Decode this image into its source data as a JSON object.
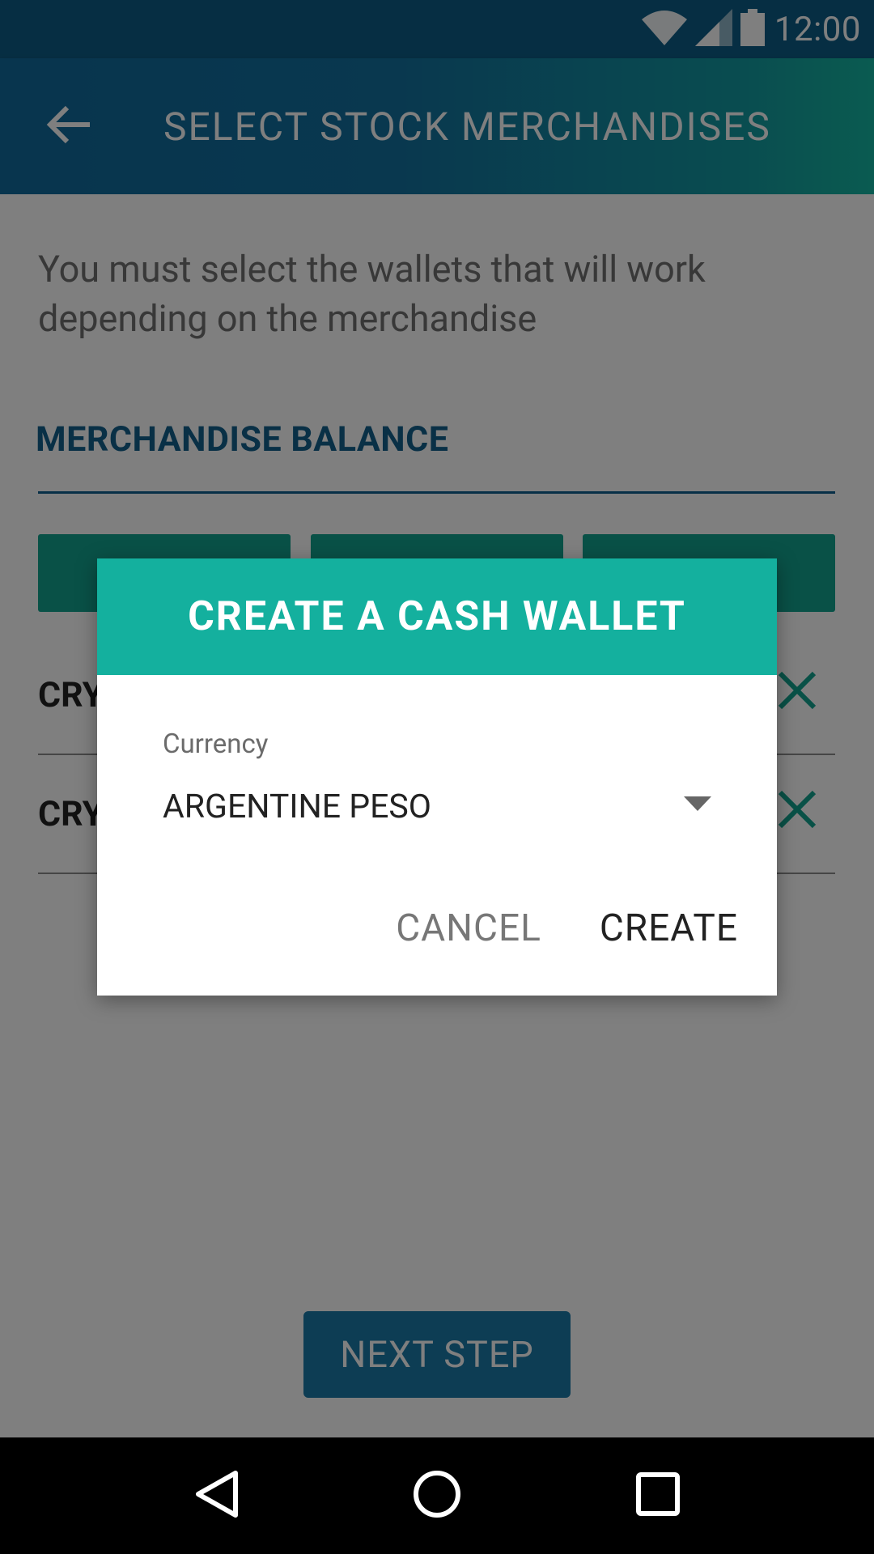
{
  "status_bar": {
    "time": "12:00"
  },
  "app_bar": {
    "title": "SELECT STOCK MERCHANDISES"
  },
  "content": {
    "instruction": "You must select the wallets that will work depending on the merchandise",
    "section_title": "MERCHANDISE BALANCE",
    "rows": [
      {
        "label": "CRY"
      },
      {
        "label": "CRY"
      }
    ],
    "next_button": "NEXT STEP"
  },
  "dialog": {
    "title": "CREATE A CASH WALLET",
    "currency_label": "Currency",
    "currency_value": "ARGENTINE PESO",
    "cancel_label": "CANCEL",
    "create_label": "CREATE"
  },
  "colors": {
    "primary": "#0d5d86",
    "accent": "#14b09e",
    "tab_green": "#13a38f"
  }
}
